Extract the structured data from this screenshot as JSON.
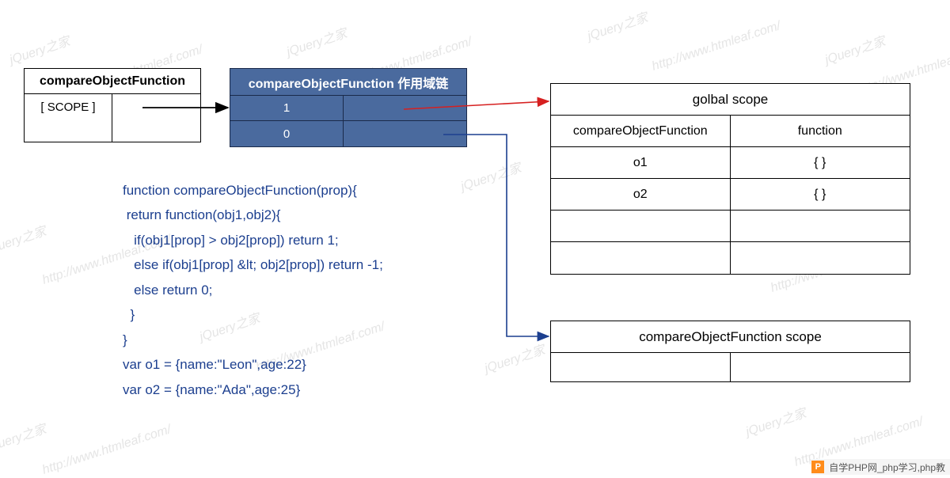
{
  "leftBox": {
    "title": "compareObjectFunction",
    "scopeLabel": "[ SCOPE ]"
  },
  "midBox": {
    "title": "compareObjectFunction 作用域链",
    "rows": [
      {
        "index": "1"
      },
      {
        "index": "0"
      }
    ]
  },
  "globalBox": {
    "title": "golbal scope",
    "rows": [
      {
        "k": "compareObjectFunction",
        "v": "function"
      },
      {
        "k": "o1",
        "v": "{ }"
      },
      {
        "k": "o2",
        "v": "{ }"
      },
      {
        "k": "",
        "v": ""
      },
      {
        "k": "",
        "v": ""
      }
    ]
  },
  "localBox": {
    "title": "compareObjectFunction scope"
  },
  "code": {
    "lines": [
      "function compareObjectFunction(prop){",
      " return function(obj1,obj2){",
      "   if(obj1[prop] > obj2[prop]) return 1;",
      "   else if(obj1[prop] &lt; obj2[prop]) return -1;",
      "   else return 0;",
      "  }",
      "}",
      "var o1 = {name:\"Leon\",age:22}",
      "var o2 = {name:\"Ada\",age:25}"
    ]
  },
  "watermarks": [
    "jQuery之家",
    "http://www.htmleaf.com/"
  ],
  "footer": {
    "badge": "P",
    "text": "自学PHP网_php学习,php教"
  }
}
